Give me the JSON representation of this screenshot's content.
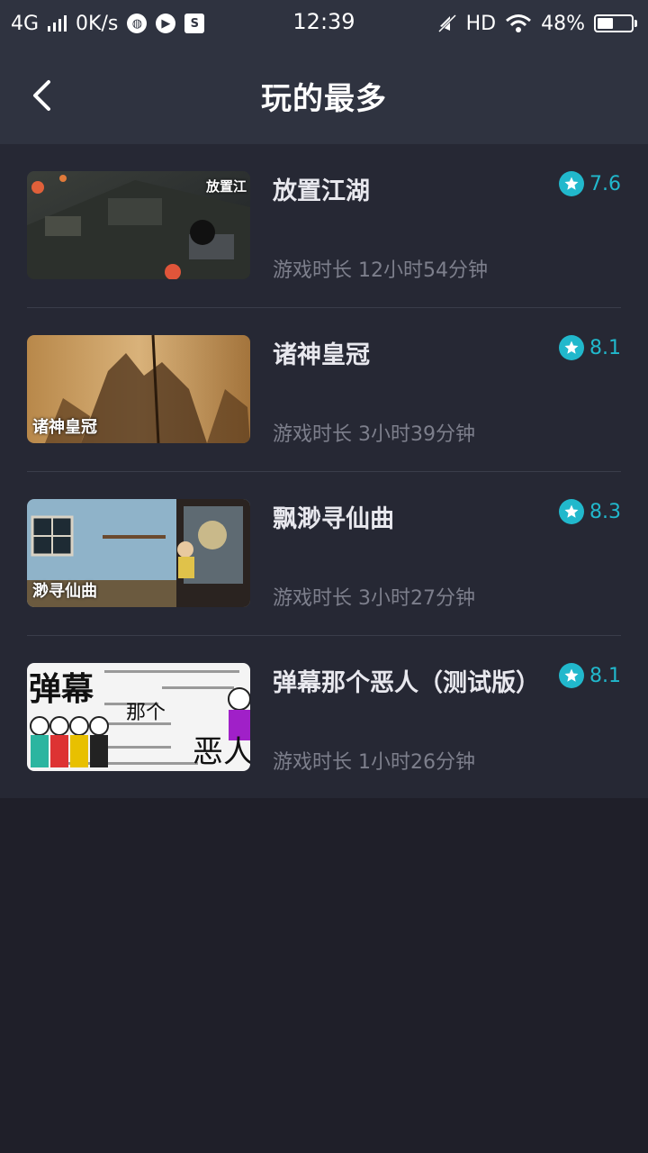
{
  "status_bar": {
    "network": "4G",
    "speed": "0K/s",
    "time": "12:39",
    "hd": "HD",
    "battery": "48%",
    "battery_level": 0.48
  },
  "header": {
    "title": "玩的最多"
  },
  "colors": {
    "accent": "#21b8cc",
    "header_bg": "#2f3340",
    "list_bg": "#262834",
    "page_bg": "#1f1f29"
  },
  "games": [
    {
      "title": "放置江湖",
      "playtime": "游戏时长 12小时54分钟",
      "rating": "7.6",
      "thumb_caption": "放置江"
    },
    {
      "title": "诸神皇冠",
      "playtime": "游戏时长 3小时39分钟",
      "rating": "8.1",
      "thumb_caption": "诸神皇冠"
    },
    {
      "title": "飘渺寻仙曲",
      "playtime": "游戏时长 3小时27分钟",
      "rating": "8.3",
      "thumb_caption": "渺寻仙曲"
    },
    {
      "title": "弹幕那个恶人（测试版）",
      "playtime": "游戏时长 1小时26分钟",
      "rating": "8.1",
      "thumb_caption": "弹幕"
    }
  ]
}
